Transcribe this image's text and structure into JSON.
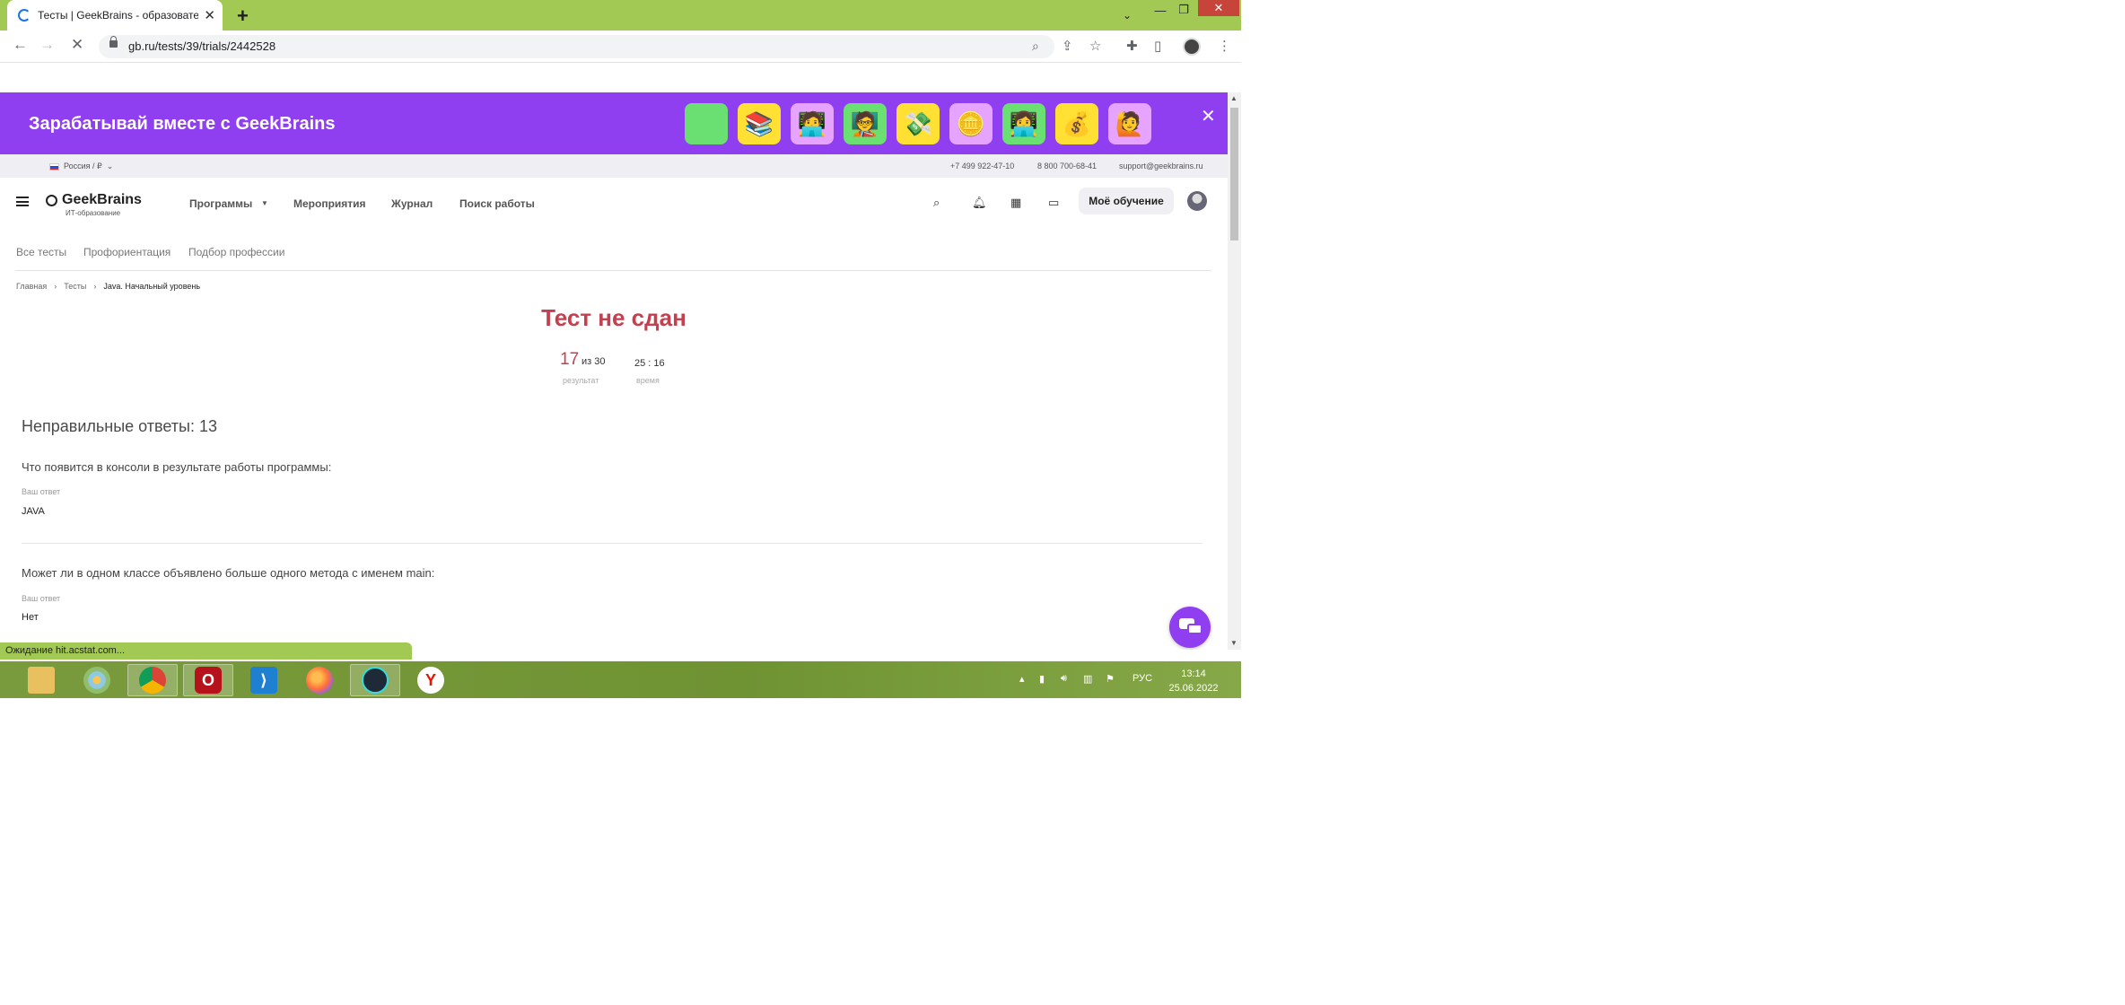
{
  "browser": {
    "tab_title": "Тесты | GeekBrains - образовате",
    "url": "gb.ru/tests/39/trials/2442528",
    "status_text": "Ожидание hit.acstat.com..."
  },
  "banner": {
    "title": "Зарабатывай вместе с GeekBrains",
    "bg_color": "#8f3ff0",
    "tiles": [
      {
        "icon": "blank-green",
        "emoji": "",
        "color": "#6be072"
      },
      {
        "icon": "books-icon",
        "emoji": "📚",
        "color": "#ffe033"
      },
      {
        "icon": "coder-icon",
        "emoji": "🧑‍💻",
        "color": "#e6a3ff"
      },
      {
        "icon": "teacher-icon",
        "emoji": "🧑‍🏫",
        "color": "#6be072"
      },
      {
        "icon": "money-wings-icon",
        "emoji": "💸",
        "color": "#ffe033"
      },
      {
        "icon": "coin-icon",
        "emoji": "🪙",
        "color": "#e6a3ff"
      },
      {
        "icon": "laptop-person-icon",
        "emoji": "👩‍💻",
        "color": "#6be072"
      },
      {
        "icon": "money-bag-icon",
        "emoji": "💰",
        "color": "#ffe033"
      },
      {
        "icon": "student-icon",
        "emoji": "🙋",
        "color": "#e6a3ff"
      }
    ]
  },
  "topstrip": {
    "region": "Россия / ₽",
    "phone1": "+7 499 922-47-10",
    "phone2": "8 800 700-68-41",
    "email": "support@geekbrains.ru"
  },
  "header": {
    "logo": "GeekBrains",
    "logo_sub": "ИТ-образование",
    "nav": [
      "Программы",
      "Мероприятия",
      "Журнал",
      "Поиск работы"
    ],
    "cta": "Моё обучение"
  },
  "subnav": [
    "Все тесты",
    "Профориентация",
    "Подбор профессии"
  ],
  "breadcrumb": [
    "Главная",
    "Тесты",
    "Java. Начальный уровень"
  ],
  "result": {
    "title": "Тест не сдан",
    "score": "17",
    "score_of": "из 30",
    "score_caption": "результат",
    "time": "25 : 16",
    "time_caption": "время",
    "accent_color": "#c3414f"
  },
  "wrong_answers": {
    "title": "Неправильные ответы: 13",
    "answer_label": "Ваш ответ",
    "items": [
      {
        "question": "Что появится в консоли в результате работы программы:",
        "answer": "JAVA"
      },
      {
        "question": "Может ли в одном классе объявлено больше одного метода с именем main:",
        "answer": "Нет"
      }
    ]
  },
  "taskbar": {
    "language": "РУС",
    "time": "13:14",
    "date": "25.06.2022"
  }
}
